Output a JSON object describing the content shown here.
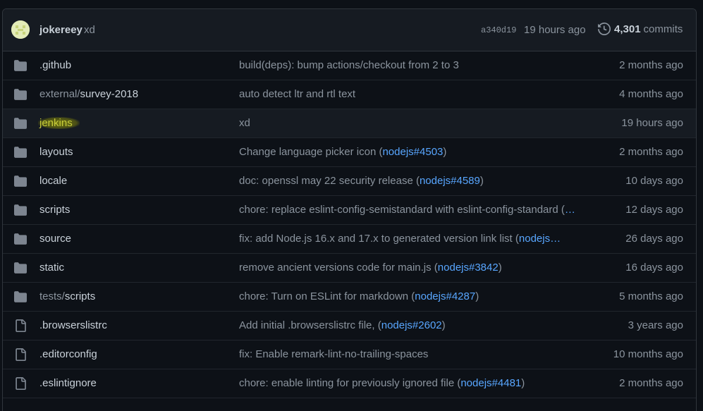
{
  "latest_commit": {
    "author": "jokereey",
    "message": "xd",
    "sha": "a340d19",
    "time": "19 hours ago",
    "commit_count": "4,301",
    "commits_label": "commits"
  },
  "rows": [
    {
      "type": "dir",
      "prefix": "",
      "name": ".github",
      "msg": "build(deps): bump actions/checkout from 2 to 3",
      "link": "",
      "suffix": "",
      "age": "2 months ago"
    },
    {
      "type": "dir",
      "prefix": "external/",
      "name": "survey-2018",
      "msg": "auto detect ltr and rtl text",
      "link": "",
      "suffix": "",
      "age": "4 months ago"
    },
    {
      "type": "dir",
      "prefix": "",
      "name": "jenkins",
      "msg": "xd",
      "link": "",
      "suffix": "",
      "age": "19 hours ago"
    },
    {
      "type": "dir",
      "prefix": "",
      "name": "layouts",
      "msg": "Change language picker icon (",
      "link": "nodejs#4503",
      "suffix": ")",
      "age": "2 months ago"
    },
    {
      "type": "dir",
      "prefix": "",
      "name": "locale",
      "msg": "doc: openssl may 22 security release (",
      "link": "nodejs#4589",
      "suffix": ")",
      "age": "10 days ago"
    },
    {
      "type": "dir",
      "prefix": "",
      "name": "scripts",
      "msg": "chore: replace eslint-config-semistandard with eslint-config-standard (",
      "link": "…",
      "suffix": "",
      "age": "12 days ago"
    },
    {
      "type": "dir",
      "prefix": "",
      "name": "source",
      "msg": "fix: add Node.js 16.x and 17.x to generated version link list (",
      "link": "nodejs…",
      "suffix": "",
      "age": "26 days ago"
    },
    {
      "type": "dir",
      "prefix": "",
      "name": "static",
      "msg": "remove ancient versions code for main.js (",
      "link": "nodejs#3842",
      "suffix": ")",
      "age": "16 days ago"
    },
    {
      "type": "dir",
      "prefix": "tests/",
      "name": "scripts",
      "msg": "chore: Turn on ESLint for markdown (",
      "link": "nodejs#4287",
      "suffix": ")",
      "age": "5 months ago"
    },
    {
      "type": "file",
      "prefix": "",
      "name": ".browserslistrc",
      "msg": "Add initial .browserslistrc file, (",
      "link": "nodejs#2602",
      "suffix": ")",
      "age": "3 years ago"
    },
    {
      "type": "file",
      "prefix": "",
      "name": ".editorconfig",
      "msg": "fix: Enable remark-lint-no-trailing-spaces",
      "link": "",
      "suffix": "",
      "age": "10 months ago"
    },
    {
      "type": "file",
      "prefix": "",
      "name": ".eslintignore",
      "msg": "chore: enable linting for previously ignored file (",
      "link": "nodejs#4481",
      "suffix": ")",
      "age": "2 months ago"
    }
  ],
  "colors": {
    "background": "#0d1117",
    "header": "#161b22",
    "text": "#c9d1d9",
    "muted": "#8b949e",
    "link": "#58a6ff",
    "folder_icon": "#7d8590",
    "highlight_marker": "#bfc400"
  },
  "icons": {
    "folder": "folder-icon",
    "file": "file-icon",
    "history": "history-icon"
  }
}
